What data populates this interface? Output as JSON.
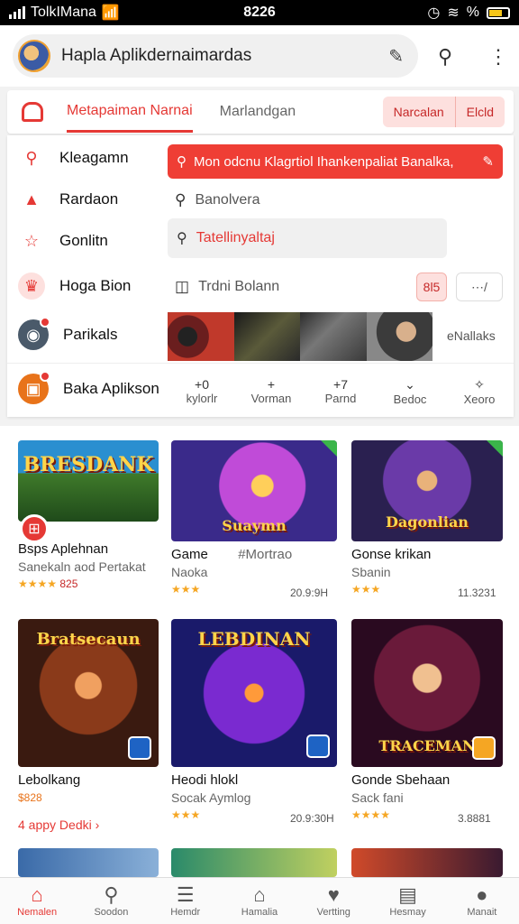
{
  "status": {
    "carrier": "TolkIMana",
    "time": "8226",
    "battery": "%"
  },
  "search": {
    "text": "Hapla Aplikdernaimardas"
  },
  "tabs": {
    "active": "Metapaiman Narnai",
    "inactive": "Marlandgan",
    "pill1": "Narcalan",
    "pill2": "Elcld"
  },
  "categories": [
    {
      "label": "Kleagamn",
      "icon": "search-icon"
    },
    {
      "label": "Rardaon",
      "icon": "pin-icon"
    },
    {
      "label": "Gonlitn",
      "icon": "star-icon"
    },
    {
      "label": "Hoga Bion",
      "icon": "crown-icon"
    },
    {
      "label": "Parikals",
      "icon": "game-icon"
    },
    {
      "label": "Baka Aplikson",
      "icon": "ticket-icon"
    }
  ],
  "banner": {
    "text": "Mon odcnu Klagrtiol Ihankenpaliat Banalka,"
  },
  "search_rows": {
    "row1": "Banolvera",
    "field": "Tatellinyaltaj",
    "row3": "Trdni Bolann"
  },
  "mini_buttons": {
    "b1": "8l5",
    "b2": "⋯/"
  },
  "strip_label": "eNallaks",
  "filters": [
    {
      "icon": "+0",
      "label": "kylorlr"
    },
    {
      "icon": "+",
      "label": "Vorman"
    },
    {
      "icon": "+7",
      "label": "Parnd"
    },
    {
      "icon": "⌄",
      "label": "Bedoc"
    },
    {
      "icon": "✧",
      "label": "Xeoro"
    }
  ],
  "cards": [
    {
      "title_art": "BRESDANK",
      "name": "Bsps Aplehnan",
      "sub": "Sanekaln aod Pertakat",
      "rating": "★★★★",
      "rating_text": "825",
      "size": ""
    },
    {
      "title_art": "Suaymn",
      "name": "Game",
      "name2": "#Mortrao",
      "sub": "Naoka",
      "rating": "★★★",
      "rating_text": "",
      "size": "20.9:9H"
    },
    {
      "title_art": "Dagonlian",
      "name": "Gonse krikan",
      "sub": "Sbanin",
      "rating": "★★★",
      "rating_text": "",
      "size": "11.3231"
    },
    {
      "title_art": "Bratsecaun",
      "name": "Lebolkang",
      "sub": "",
      "rating": "",
      "rating_text": "$828",
      "size": ""
    },
    {
      "title_art": "LEBDINAN",
      "name": "Heodi hlokl",
      "sub": "Socak Aymlog",
      "rating": "★★★",
      "rating_text": "",
      "size": "20.9:30H"
    },
    {
      "title_art": "TRACEMAN",
      "name": "Gonde Sbehaan",
      "sub": "Sack fani",
      "rating": "★★★★",
      "rating_text": "",
      "size": "3.8881"
    }
  ],
  "app_link": "4 appy Dedki ›",
  "bottom_nav": [
    {
      "label": "Nemalen",
      "icon": "home-icon",
      "active": true
    },
    {
      "label": "Soodon",
      "icon": "search-icon",
      "active": false
    },
    {
      "label": "Hemdr",
      "icon": "list-icon",
      "active": false
    },
    {
      "label": "Hamalia",
      "icon": "bank-icon",
      "active": false
    },
    {
      "label": "Vertting",
      "icon": "heart-icon",
      "active": false
    },
    {
      "label": "Hesmay",
      "icon": "apps-icon",
      "active": false
    },
    {
      "label": "Manait",
      "icon": "person-icon",
      "active": false
    }
  ]
}
